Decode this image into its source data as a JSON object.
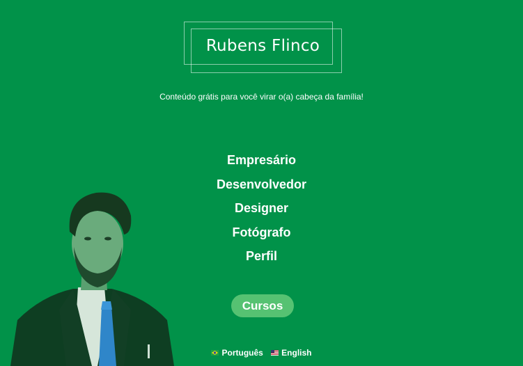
{
  "logo": {
    "text": "Rubens Flinco"
  },
  "tagline": "Conteúdo grátis para você virar o(a) cabeça da família!",
  "menu": {
    "items": [
      {
        "label": "Empresário"
      },
      {
        "label": "Desenvolvedor"
      },
      {
        "label": "Designer"
      },
      {
        "label": "Fotógrafo"
      },
      {
        "label": "Perfil"
      }
    ]
  },
  "cta": {
    "label": "Cursos"
  },
  "languages": [
    {
      "label": "Português",
      "flag": "brazil-flag-icon"
    },
    {
      "label": "English",
      "flag": "usa-flag-icon"
    }
  ],
  "colors": {
    "background": "#019249",
    "cta_background": "#56c272",
    "text": "#ffffff"
  }
}
